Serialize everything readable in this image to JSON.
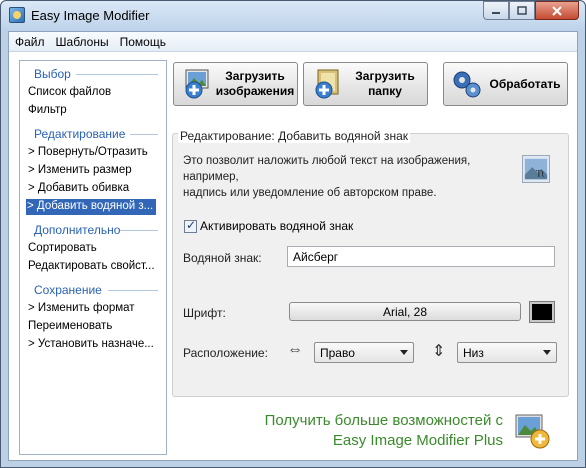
{
  "window": {
    "title": "Easy Image Modifier"
  },
  "menu": [
    "Файл",
    "Шаблоны",
    "Помощь"
  ],
  "sidebar": {
    "sections": [
      {
        "title": "Выбор",
        "items": [
          "Список файлов",
          "Фильтр"
        ]
      },
      {
        "title": "Редактирование",
        "items": [
          "> Повернуть/Отразить",
          "> Изменить размер",
          "> Добавить обивка",
          "> Добавить водяной з..."
        ]
      },
      {
        "title": "Дополнительно",
        "items": [
          "Сортировать",
          "Редактировать свойст..."
        ]
      },
      {
        "title": "Сохранение",
        "items": [
          "> Изменить формат",
          "Переименовать",
          "> Установить назначе..."
        ]
      }
    ],
    "selected": "> Добавить водяной з..."
  },
  "toolbar": {
    "load_images": [
      "Загрузить",
      "изображения"
    ],
    "load_folder": [
      "Загрузить",
      "папку"
    ],
    "process": "Обработать"
  },
  "panel": {
    "group_title": "Редактирование: Добавить водяной знак",
    "description": [
      "Это позволит наложить любой текст на изображения, например,",
      "надпись или уведомление об авторском праве."
    ],
    "activate_label": "Активировать водяной знак",
    "activate_checked": true,
    "watermark_label": "Водяной знак:",
    "watermark_value": "Айсберг",
    "font_label": "Шрифт:",
    "font_value": "Arial, 28",
    "font_color": "#000000",
    "position_label": "Расположение:",
    "horizontal_value": "Право",
    "vertical_value": "Низ"
  },
  "promo": [
    "Получить больше возможностей с",
    "Easy Image Modifier Plus"
  ],
  "icons": {
    "horizontal": "left-right-arrow-icon",
    "vertical": "up-down-arrow-icon"
  },
  "colors": {
    "accent": "#3267b8",
    "promo": "#3a8b2c",
    "section_header": "#2a62b4"
  }
}
